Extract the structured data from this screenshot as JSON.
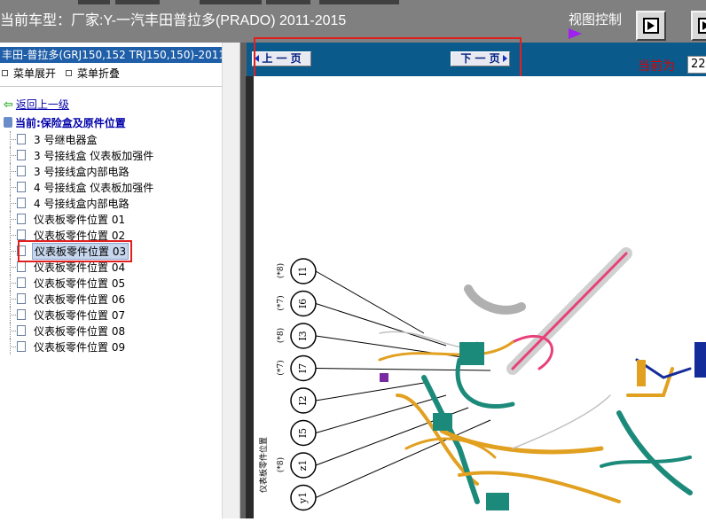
{
  "header": {
    "title": "当前车型：厂家:Y-一汽丰田普拉多(PRADO) 2011-2015",
    "view_control_label": "视图控制"
  },
  "sidebar": {
    "model_label": "丰田-普拉多(GRJ150,152 TRJ150,150)-2011",
    "expand_label": "菜单展开",
    "collapse_label": "菜单折叠",
    "back_label": "返回上一级",
    "current_label": "当前:保险盒及原件位置",
    "items": [
      {
        "label": "3 号继电器盒"
      },
      {
        "label": "3 号接线盒 仪表板加强件"
      },
      {
        "label": "3 号接线盒内部电路"
      },
      {
        "label": "4 号接线盒 仪表板加强件"
      },
      {
        "label": "4 号接线盒内部电路"
      },
      {
        "label": "仪表板零件位置 01"
      },
      {
        "label": "仪表板零件位置 02"
      },
      {
        "label": "仪表板零件位置 03",
        "selected": true
      },
      {
        "label": "仪表板零件位置 04"
      },
      {
        "label": "仪表板零件位置 05"
      },
      {
        "label": "仪表板零件位置 06"
      },
      {
        "label": "仪表板零件位置 07"
      },
      {
        "label": "仪表板零件位置 08"
      },
      {
        "label": "仪表板零件位置 09"
      }
    ]
  },
  "nav": {
    "prev_label": "上 一 页",
    "next_label": "下 一 页",
    "current_page_label": "当前为",
    "current_page_value": "22"
  },
  "diagram": {
    "side_label": "仪表板零件位置",
    "callouts": [
      {
        "id": "I1",
        "note": ""
      },
      {
        "id": "I6",
        "note": "(*8)"
      },
      {
        "id": "I3",
        "note": "(*7)"
      },
      {
        "id": "I7",
        "note": "(*8)"
      },
      {
        "id": "I2",
        "note": "(*7)"
      },
      {
        "id": "I5",
        "note": ""
      },
      {
        "id": "z1",
        "note": ""
      },
      {
        "id": "y1",
        "note": "(*8)"
      }
    ]
  }
}
